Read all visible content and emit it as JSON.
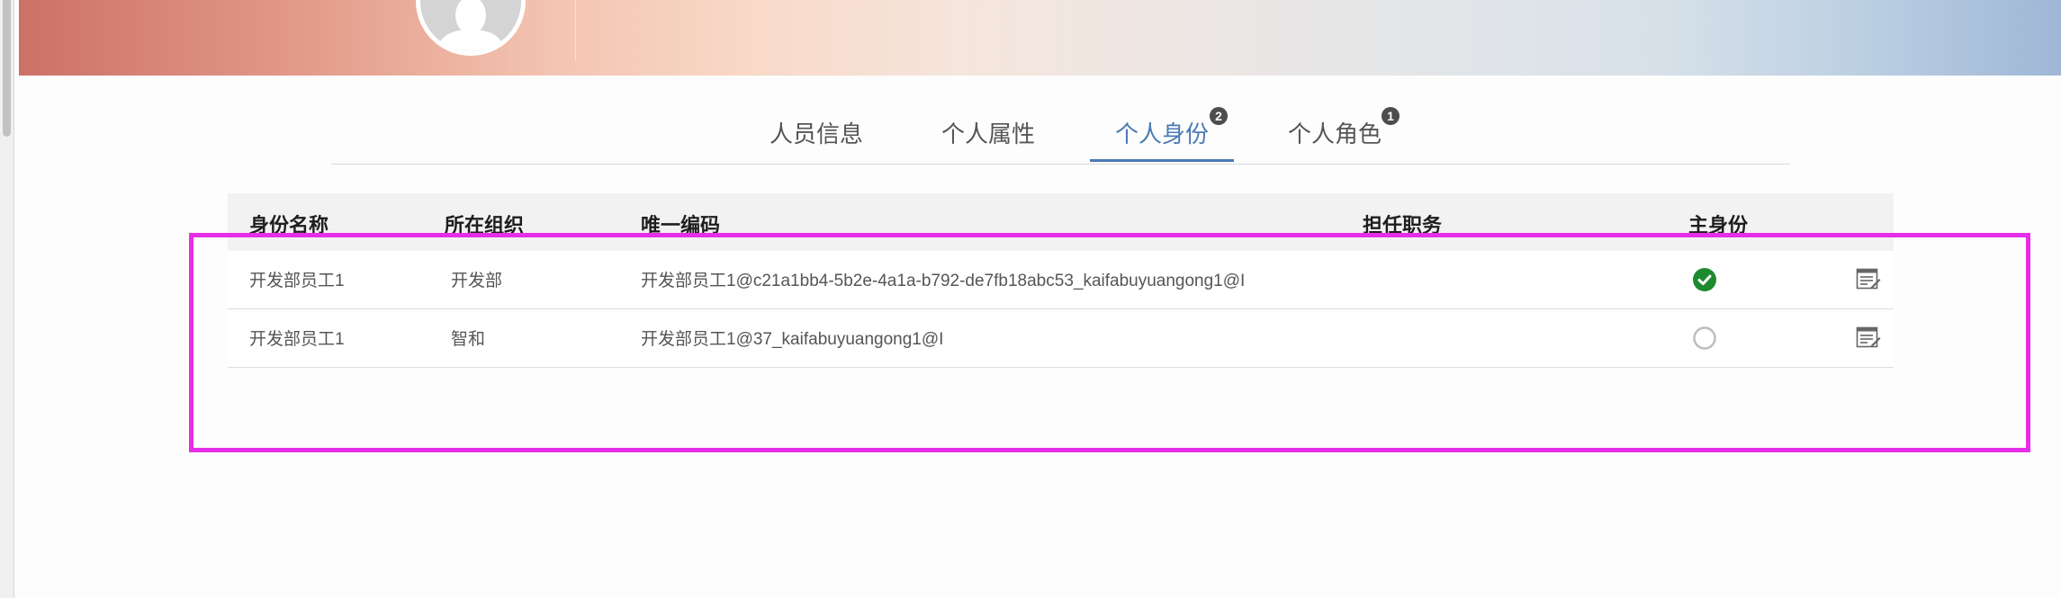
{
  "tabs": [
    {
      "label": "人员信息",
      "active": false,
      "badge": ""
    },
    {
      "label": "个人属性",
      "active": false,
      "badge": ""
    },
    {
      "label": "个人身份",
      "active": true,
      "badge": "2"
    },
    {
      "label": "个人角色",
      "active": false,
      "badge": "1"
    }
  ],
  "table": {
    "headers": [
      "身份名称",
      "所在组织",
      "唯一编码",
      "担任职务",
      "主身份"
    ],
    "rows": [
      {
        "name": "开发部员工1",
        "org": "开发部",
        "code": "开发部员工1@c21a1bb4-5b2e-4a1a-b792-de7fb18abc53_kaifabuyuangong1@I",
        "position": "",
        "primary": true
      },
      {
        "name": "开发部员工1",
        "org": "智和",
        "code": "开发部员工1@37_kaifabuyuangong1@I",
        "position": "",
        "primary": false
      }
    ]
  },
  "colors": {
    "accent": "#4a7ab4",
    "primary_check": "#1e8a2e",
    "highlight": "#e62ee6",
    "badge": "#4d4d4d"
  },
  "icons": {
    "avatar": "user-silhouette-icon",
    "primary_on": "check-circle-icon",
    "primary_off": "radio-empty-icon",
    "edit": "edit-document-icon"
  }
}
